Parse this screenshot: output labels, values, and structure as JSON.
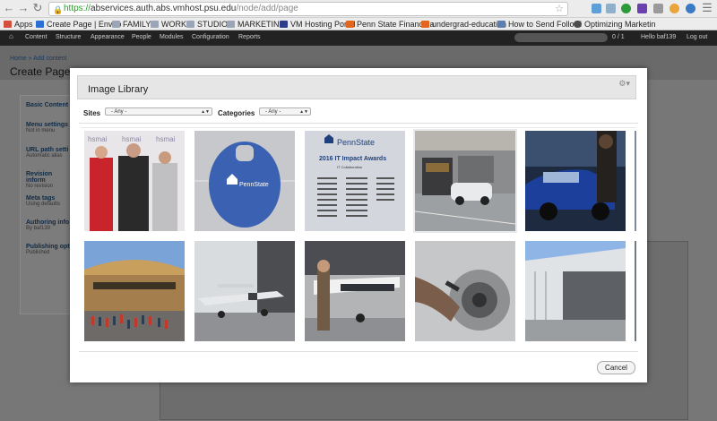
{
  "browser": {
    "url_prefix": "https://",
    "url_host": "abservices.auth.abs.vmhost.psu.edu",
    "url_path": "/node/add/page",
    "bookmarks": [
      "Apps",
      "Create Page | Enviro",
      "FAMILY",
      "WORK",
      "STUDIO",
      "MARKETING",
      "VM Hosting Portal",
      "Penn State Finance a",
      "undergrad-education",
      "How to Send Followi",
      "Optimizing Marketin"
    ]
  },
  "admin": {
    "items": [
      "Content",
      "Structure",
      "Appearance",
      "People",
      "Modules",
      "Configuration",
      "Reports"
    ],
    "count": "0 / 1",
    "hello": "Hello baf139",
    "logout": "Log out"
  },
  "page": {
    "breadcrumb": "Home » Add content",
    "title": "Create Page"
  },
  "vertical_tabs": [
    {
      "title": "Basic Content",
      "sub": ""
    },
    {
      "title": "Menu settings",
      "sub": "Not in menu"
    },
    {
      "title": "URL path setti",
      "sub": "Automatic alias"
    },
    {
      "title": "Revision inform",
      "sub": "No revision"
    },
    {
      "title": "Meta tags",
      "sub": "Using defaults"
    },
    {
      "title": "Authoring info",
      "sub": "By baf139"
    },
    {
      "title": "Publishing opt",
      "sub": "Published"
    }
  ],
  "modal": {
    "title": "Image Library",
    "sites_label": "Sites",
    "sites_value": "- Any -",
    "categories_label": "Categories",
    "categories_value": "- Any -",
    "cancel_label": "Cancel",
    "thumb_text": {
      "hsmai": "hsmai",
      "pennstate_tag": "PennState",
      "pennstate_award": "PennState",
      "award_title": "2016 IT Impact Awards",
      "award_sub": "IT Collaboration"
    },
    "images": [
      {
        "name": "hsmai award photo"
      },
      {
        "name": "penn state tag"
      },
      {
        "name": "it impact awards"
      },
      {
        "name": "parking garage car"
      },
      {
        "name": "blue car"
      },
      {
        "name": "campus building crowd"
      },
      {
        "name": "airplane at hangar"
      },
      {
        "name": "pilot with airplane"
      },
      {
        "name": "mechanic with wheel"
      },
      {
        "name": "hangar building"
      }
    ]
  }
}
